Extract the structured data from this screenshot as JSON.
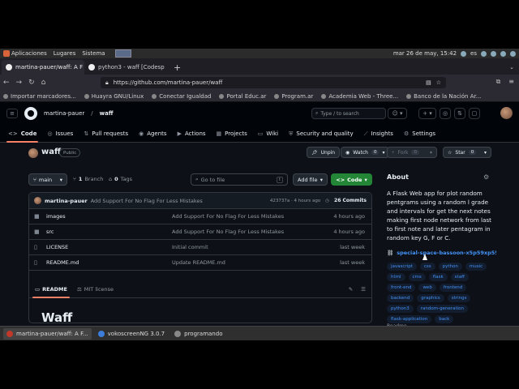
{
  "os": {
    "menu": [
      "Aplicaciones",
      "Lugares",
      "Sistema"
    ],
    "clock": "mar 26 de may, 15:42",
    "keyboard": "es"
  },
  "browser": {
    "tabs": [
      {
        "title": "martina-pauer/waff: A F",
        "active": true
      },
      {
        "title": "python3 - waff [Codesp",
        "active": false
      }
    ],
    "newtab": "+",
    "url": "https://github.com/martina-pauer/waff",
    "bookmarks": [
      "Importar marcadores...",
      "Huayra GNU/Linux",
      "Conectar Igualdad",
      "Portal Educ.ar",
      "Program.ar",
      "Academia Web - Three...",
      "Banco de la Nación Ar..."
    ]
  },
  "github": {
    "owner": "martina-pauer",
    "repo": "waff",
    "search_placeholder": "Type / to search",
    "nav": [
      {
        "label": "Code",
        "icon": "<>"
      },
      {
        "label": "Issues",
        "icon": "◎"
      },
      {
        "label": "Pull requests",
        "icon": "⇅"
      },
      {
        "label": "Agents",
        "icon": "◉"
      },
      {
        "label": "Actions",
        "icon": "▶"
      },
      {
        "label": "Projects",
        "icon": "▦"
      },
      {
        "label": "Wiki",
        "icon": "▭"
      },
      {
        "label": "Security and quality",
        "icon": "⛨"
      },
      {
        "label": "Insights",
        "icon": "⟋"
      },
      {
        "label": "Settings",
        "icon": "⚙"
      }
    ]
  },
  "repo_head": {
    "title": "waff",
    "visibility": "Public",
    "unpin": "Unpin",
    "watch": {
      "label": "Watch",
      "count": "0"
    },
    "fork": {
      "label": "Fork",
      "count": "0"
    },
    "star": {
      "label": "Star",
      "count": "0"
    }
  },
  "files": {
    "branch": "main",
    "branches": {
      "count": "1",
      "label": "Branch"
    },
    "tags": {
      "count": "0",
      "label": "Tags"
    },
    "go_to_file": "Go to file",
    "shortcut": "t",
    "add_file": "Add file",
    "code": "Code",
    "last_commit": {
      "author": "martina-pauer",
      "message": "Add Support For No Flag For Less Mistakes",
      "hash": "423737a · 4 hours ago",
      "commits": "26 Commits"
    },
    "rows": [
      {
        "name": "images",
        "type": "folder",
        "message": "Add Support For No Flag For Less Mistakes",
        "time": "4 hours ago"
      },
      {
        "name": "src",
        "type": "folder",
        "message": "Add Support For No Flag For Less Mistakes",
        "time": "4 hours ago"
      },
      {
        "name": "LICENSE",
        "type": "file",
        "message": "Initial commit",
        "time": "last week"
      },
      {
        "name": "README.md",
        "type": "file",
        "message": "Update README.md",
        "time": "last week"
      }
    ]
  },
  "readme": {
    "tab_readme": "README",
    "tab_license": "MIT license",
    "title": "Waff"
  },
  "about": {
    "title": "About",
    "description": "A Flask Web app for plot random pentgrams using a random l grade and intervals for get the next notes making first node network from last to first note and later pentagram in random key G, F or C.",
    "link": "special-space-bassoon-x5p59xp55...",
    "topics": [
      "javascript",
      "css",
      "python",
      "music",
      "html",
      "cms",
      "flask",
      "staff",
      "front-end",
      "web",
      "frontend",
      "backend",
      "graphics",
      "strings",
      "python3",
      "random-generation",
      "flask-application",
      "back"
    ],
    "more": "Readme"
  },
  "taskbar": [
    {
      "label": "martina-pauer/waff: A F...",
      "color": "#c0392b",
      "active": true
    },
    {
      "label": "vokoscreenNG 3.0.7",
      "color": "#3b7dd8",
      "active": false
    },
    {
      "label": "programando",
      "color": "#888888",
      "active": false
    }
  ]
}
